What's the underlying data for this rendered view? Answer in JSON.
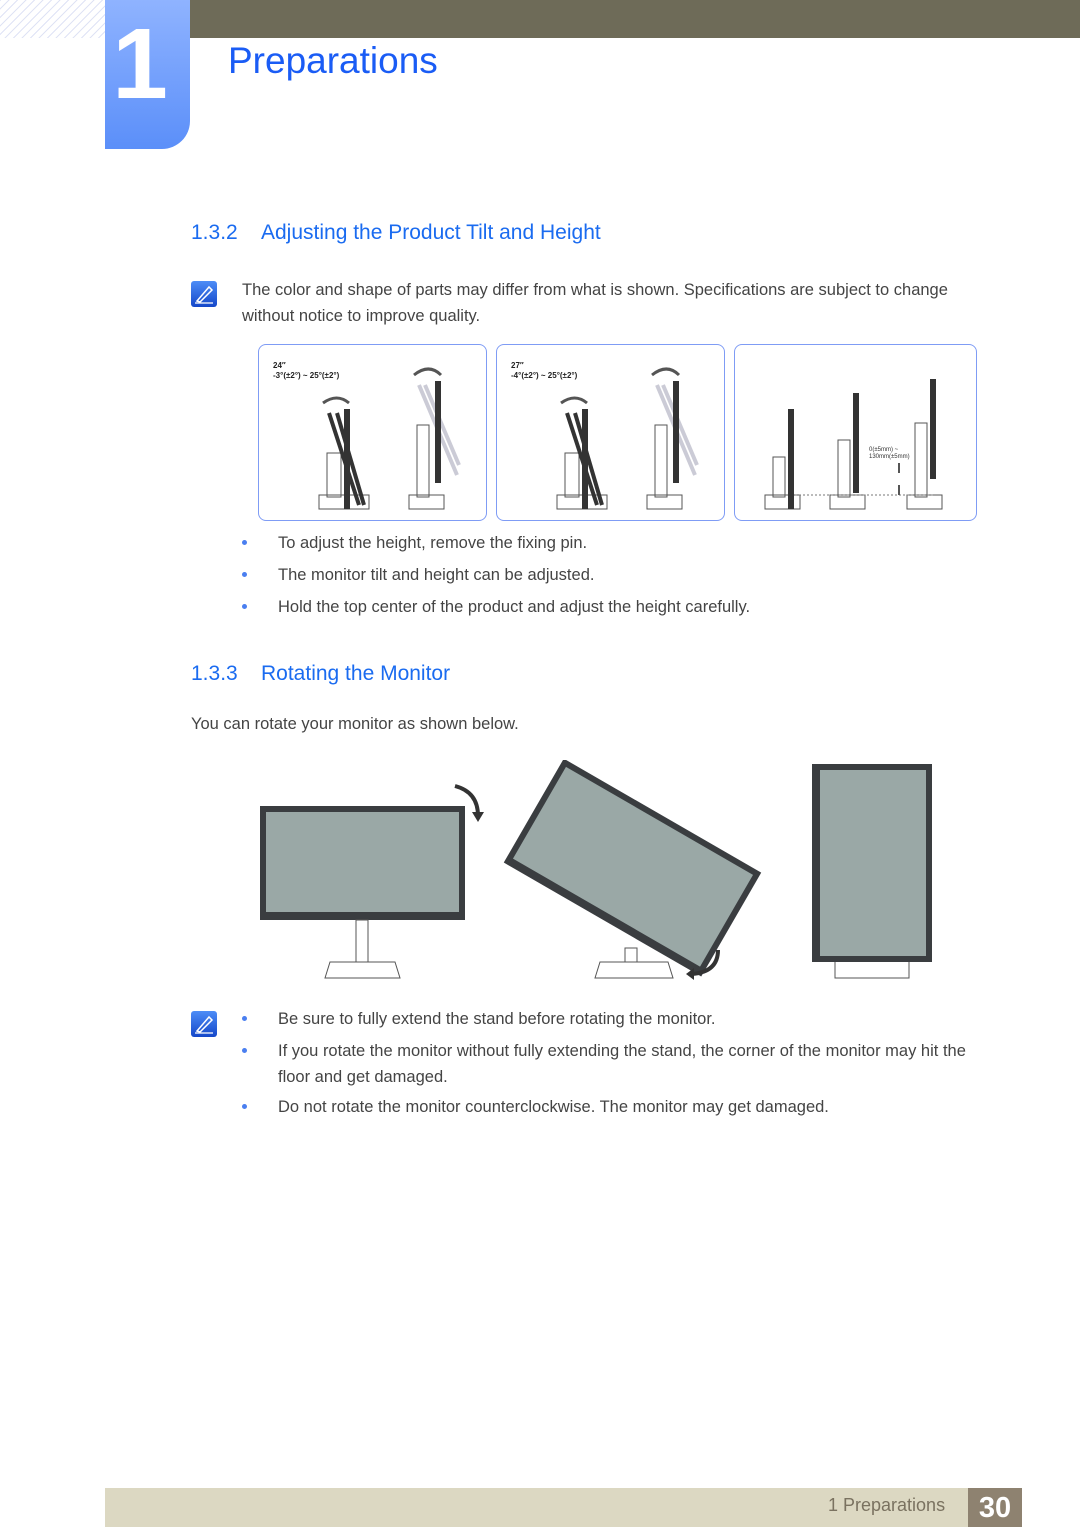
{
  "header": {
    "chapter_number": "1",
    "chapter_title": "Preparations"
  },
  "section_132": {
    "number": "1.3.2",
    "title": "Adjusting the Product Tilt and Height",
    "note": "The color and shape of parts may differ from what is shown. Specifications are subject to change without notice to improve quality.",
    "figures": {
      "fig1_size": "24″",
      "fig1_range": "-3°(±2°) ~ 25°(±2°)",
      "fig2_size": "27″",
      "fig2_range": "-4°(±2°) ~ 25°(±2°)",
      "fig3_line1": "0(±5mm) ~",
      "fig3_line2": "130mm(±5mm)"
    },
    "bullets": [
      "To adjust the height, remove the fixing pin.",
      "The monitor tilt and height can be adjusted.",
      "Hold the top center of the product and adjust the height carefully."
    ]
  },
  "section_133": {
    "number": "1.3.3",
    "title": "Rotating the Monitor",
    "intro": "You can rotate your monitor as shown below.",
    "bullets": [
      "Be sure to fully extend the stand before rotating the monitor.",
      "If you rotate the monitor without fully extending the stand, the corner of the monitor may hit the floor and get damaged.",
      "Do not rotate the monitor counterclockwise. The monitor may get damaged."
    ]
  },
  "footer": {
    "chapter_label": "1 Preparations",
    "page_number": "30"
  },
  "colors": {
    "accent": "#1a6bf0",
    "top_bar": "#6e6b58",
    "footer_bg": "#dcd8c2",
    "page_num_bg": "#8e8270"
  },
  "icons": [
    "note-icon",
    "bullet-icon",
    "rotate-arrow-icon"
  ]
}
